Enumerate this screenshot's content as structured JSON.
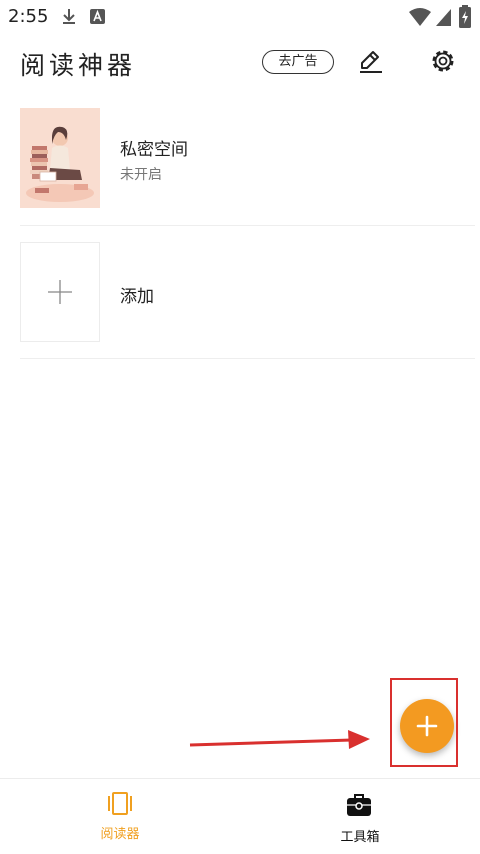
{
  "status_bar": {
    "time": "2:55",
    "icons": [
      "download-icon",
      "app-notification-icon",
      "wifi-icon",
      "signal-icon",
      "battery-icon"
    ]
  },
  "header": {
    "title": "阅读神器",
    "ad_button_label": "去广告",
    "icons": [
      "edit-icon",
      "gear-icon"
    ]
  },
  "items": [
    {
      "title": "私密空间",
      "subtitle": "未开启",
      "thumbnail": "reading-girl-illustration"
    },
    {
      "title": "添加",
      "thumbnail": "plus-icon"
    }
  ],
  "fab": {
    "icon": "plus-icon",
    "color": "#f39a21"
  },
  "annotation": {
    "color": "#d9302e"
  },
  "bottom_nav": {
    "tabs": [
      {
        "label": "阅读器",
        "icon": "reader-icon",
        "active": true
      },
      {
        "label": "工具箱",
        "icon": "toolbox-icon",
        "active": false
      }
    ],
    "active_color": "#f0a020"
  }
}
